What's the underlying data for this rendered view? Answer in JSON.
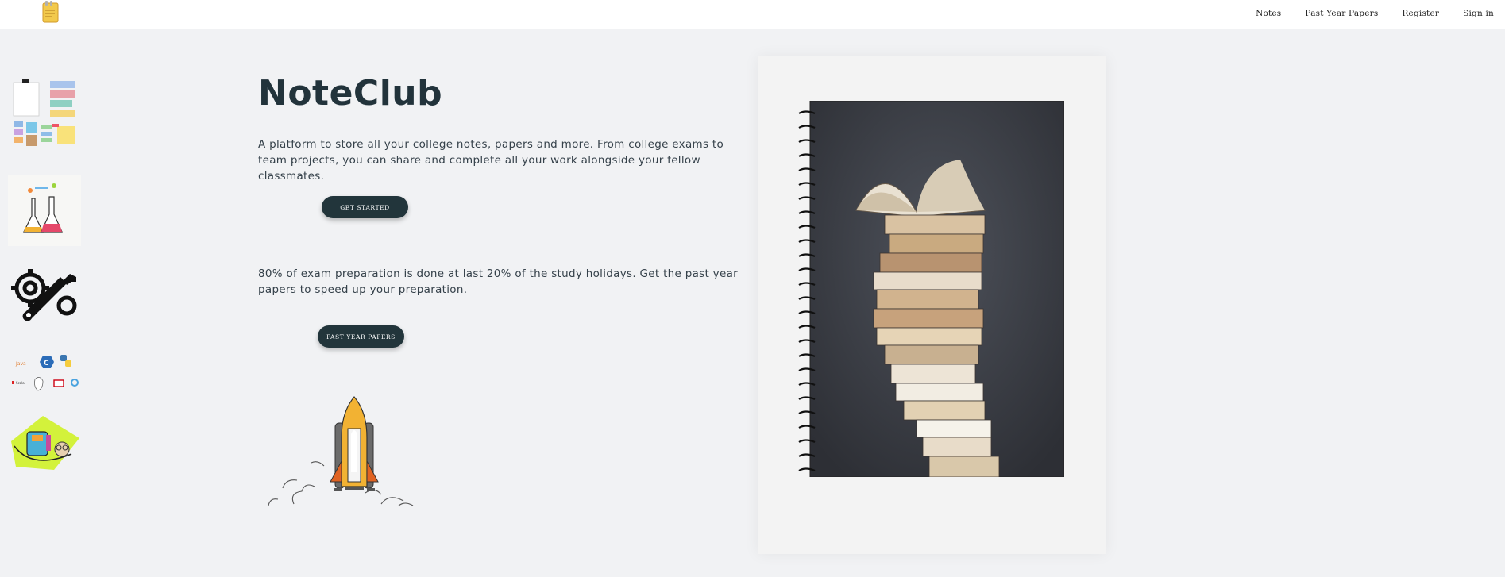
{
  "nav": {
    "links": [
      "Notes",
      "Past Year Papers",
      "Register",
      "Sign in"
    ]
  },
  "hero": {
    "title": "NoteClub",
    "description": "A platform to store all your college notes, papers and more. From college exams to team projects, you can share and complete all your work alongside your fellow classmates.",
    "get_started_label": "GET STARTED",
    "papers_text": "80% of exam preparation is done at last 20% of the study holidays. Get the past year papers to speed up your preparation.",
    "papers_button_label": "PAST YEAR PAPERS"
  },
  "sidebar": {
    "icons": [
      "sticky-notes-icon",
      "lab-flasks-icon",
      "settings-wrench-icon",
      "programming-languages-icon",
      "study-backpack-icon"
    ]
  },
  "colors": {
    "background": "#f1f2f4",
    "accent": "#22353b",
    "title": "#22333b"
  }
}
